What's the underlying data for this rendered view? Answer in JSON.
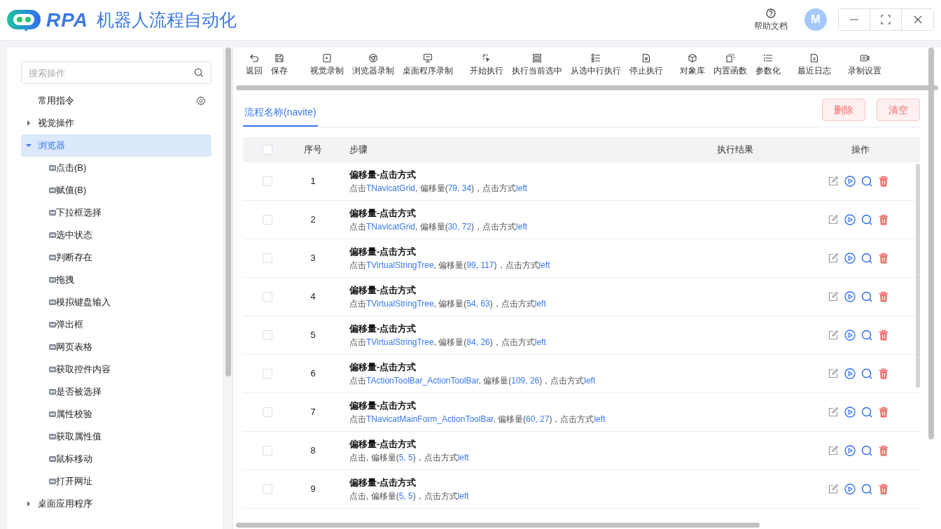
{
  "header": {
    "logo_text": "RPA",
    "title": "机器人流程自动化",
    "help_label": "帮助文档",
    "avatar_initial": "M"
  },
  "sidebar": {
    "search": {
      "placeholder": "搜索操作"
    },
    "items": [
      {
        "label": "常用指令",
        "kind": "pinned",
        "selected": false
      },
      {
        "label": "视觉操作",
        "kind": "group",
        "expanded": false,
        "selected": false
      },
      {
        "label": "浏览器",
        "kind": "group",
        "expanded": true,
        "selected": true,
        "children": [
          {
            "label": "点击(B)",
            "kind": "command",
            "selected": false
          },
          {
            "label": "赋值(B)",
            "kind": "command",
            "selected": false
          },
          {
            "label": "下拉框选择",
            "kind": "command",
            "selected": false
          },
          {
            "label": "选中状态",
            "kind": "command",
            "selected": false
          },
          {
            "label": "判断存在",
            "kind": "command",
            "selected": false
          },
          {
            "label": "拖拽",
            "kind": "command",
            "selected": false
          },
          {
            "label": "模拟键盘输入",
            "kind": "command",
            "selected": false
          },
          {
            "label": "弹出框",
            "kind": "command",
            "selected": false
          },
          {
            "label": "网页表格",
            "kind": "command",
            "selected": false
          },
          {
            "label": "获取控件内容",
            "kind": "command",
            "selected": false
          },
          {
            "label": "是否被选择",
            "kind": "command",
            "selected": false
          },
          {
            "label": "属性校验",
            "kind": "command",
            "selected": false
          },
          {
            "label": "获取属性值",
            "kind": "command",
            "selected": false
          },
          {
            "label": "鼠标移动",
            "kind": "command",
            "selected": false
          },
          {
            "label": "打开网址",
            "kind": "command",
            "selected": false
          }
        ]
      },
      {
        "label": "桌面应用程序",
        "kind": "group",
        "expanded": false,
        "selected": false
      }
    ]
  },
  "toolbar": [
    "返回",
    "保存",
    "视觉录制",
    "浏览器录制",
    "桌面程序录制",
    "开始执行",
    "执行当前选中",
    "从选中行执行",
    "停止执行",
    "对象库",
    "内置函数",
    "参数化",
    "最近日志",
    "录制设置"
  ],
  "tabs": [
    {
      "label": "流程名称(navite)",
      "selected": true
    }
  ],
  "actions": [
    "删除",
    "清空"
  ],
  "table": {
    "columns": [
      "序号",
      "步骤",
      "执行结果",
      "操作"
    ],
    "all_checked": false,
    "rows": [
      {
        "checked": false,
        "index": "1",
        "title": "偏移量-点击方式",
        "description": [
          {
            "text": "点击",
            "kind": "plain"
          },
          {
            "text": "TNavicatGrid",
            "kind": "value"
          },
          {
            "text": ", 偏移量(",
            "kind": "plain"
          },
          {
            "text": "79, 34",
            "kind": "value"
          },
          {
            "text": ")，点击方式",
            "kind": "plain"
          },
          {
            "text": "left",
            "kind": "value"
          }
        ]
      },
      {
        "checked": false,
        "index": "2",
        "title": "偏移量-点击方式",
        "description": [
          {
            "text": "点击",
            "kind": "plain"
          },
          {
            "text": "TNavicatGrid",
            "kind": "value"
          },
          {
            "text": ", 偏移量(",
            "kind": "plain"
          },
          {
            "text": "30, 72",
            "kind": "value"
          },
          {
            "text": ")，点击方式",
            "kind": "plain"
          },
          {
            "text": "left",
            "kind": "value"
          }
        ]
      },
      {
        "checked": false,
        "index": "3",
        "title": "偏移量-点击方式",
        "description": [
          {
            "text": "点击",
            "kind": "plain"
          },
          {
            "text": "TVirtualStringTree",
            "kind": "value"
          },
          {
            "text": ", 偏移量(",
            "kind": "plain"
          },
          {
            "text": "99, 117",
            "kind": "value"
          },
          {
            "text": ")，点击方式",
            "kind": "plain"
          },
          {
            "text": "left",
            "kind": "value"
          }
        ]
      },
      {
        "checked": false,
        "index": "4",
        "title": "偏移量-点击方式",
        "description": [
          {
            "text": "点击",
            "kind": "plain"
          },
          {
            "text": "TVirtualStringTree",
            "kind": "value"
          },
          {
            "text": ", 偏移量(",
            "kind": "plain"
          },
          {
            "text": "54, 63",
            "kind": "value"
          },
          {
            "text": ")，点击方式",
            "kind": "plain"
          },
          {
            "text": "left",
            "kind": "value"
          }
        ]
      },
      {
        "checked": false,
        "index": "5",
        "title": "偏移量-点击方式",
        "description": [
          {
            "text": "点击",
            "kind": "plain"
          },
          {
            "text": "TVirtualStringTree",
            "kind": "value"
          },
          {
            "text": ", 偏移量(",
            "kind": "plain"
          },
          {
            "text": "84, 26",
            "kind": "value"
          },
          {
            "text": ")，点击方式",
            "kind": "plain"
          },
          {
            "text": "left",
            "kind": "value"
          }
        ]
      },
      {
        "checked": false,
        "index": "6",
        "title": "偏移量-点击方式",
        "description": [
          {
            "text": "点击",
            "kind": "plain"
          },
          {
            "text": "TActionToolBar_ActionToolBar",
            "kind": "value"
          },
          {
            "text": ", 偏移量(",
            "kind": "plain"
          },
          {
            "text": "109, 26",
            "kind": "value"
          },
          {
            "text": ")，点击方式",
            "kind": "plain"
          },
          {
            "text": "left",
            "kind": "value"
          }
        ]
      },
      {
        "checked": false,
        "index": "7",
        "title": "偏移量-点击方式",
        "description": [
          {
            "text": "点击",
            "kind": "plain"
          },
          {
            "text": "TNavicatMainForm_ActionToolBar",
            "kind": "value"
          },
          {
            "text": ", 偏移量(",
            "kind": "plain"
          },
          {
            "text": "60, 27",
            "kind": "value"
          },
          {
            "text": ")，点击方式",
            "kind": "plain"
          },
          {
            "text": "left",
            "kind": "value"
          }
        ]
      },
      {
        "checked": false,
        "index": "8",
        "title": "偏移量-点击方式",
        "description": [
          {
            "text": "点击, 偏移量(",
            "kind": "plain"
          },
          {
            "text": "5, 5",
            "kind": "value"
          },
          {
            "text": ")，点击方式",
            "kind": "plain"
          },
          {
            "text": "left",
            "kind": "value"
          }
        ]
      },
      {
        "checked": false,
        "index": "9",
        "title": "偏移量-点击方式",
        "description": [
          {
            "text": "点击, 偏移量(",
            "kind": "plain"
          },
          {
            "text": "5, 5",
            "kind": "value"
          },
          {
            "text": ")，点击方式",
            "kind": "plain"
          },
          {
            "text": "left",
            "kind": "value"
          }
        ]
      }
    ]
  }
}
